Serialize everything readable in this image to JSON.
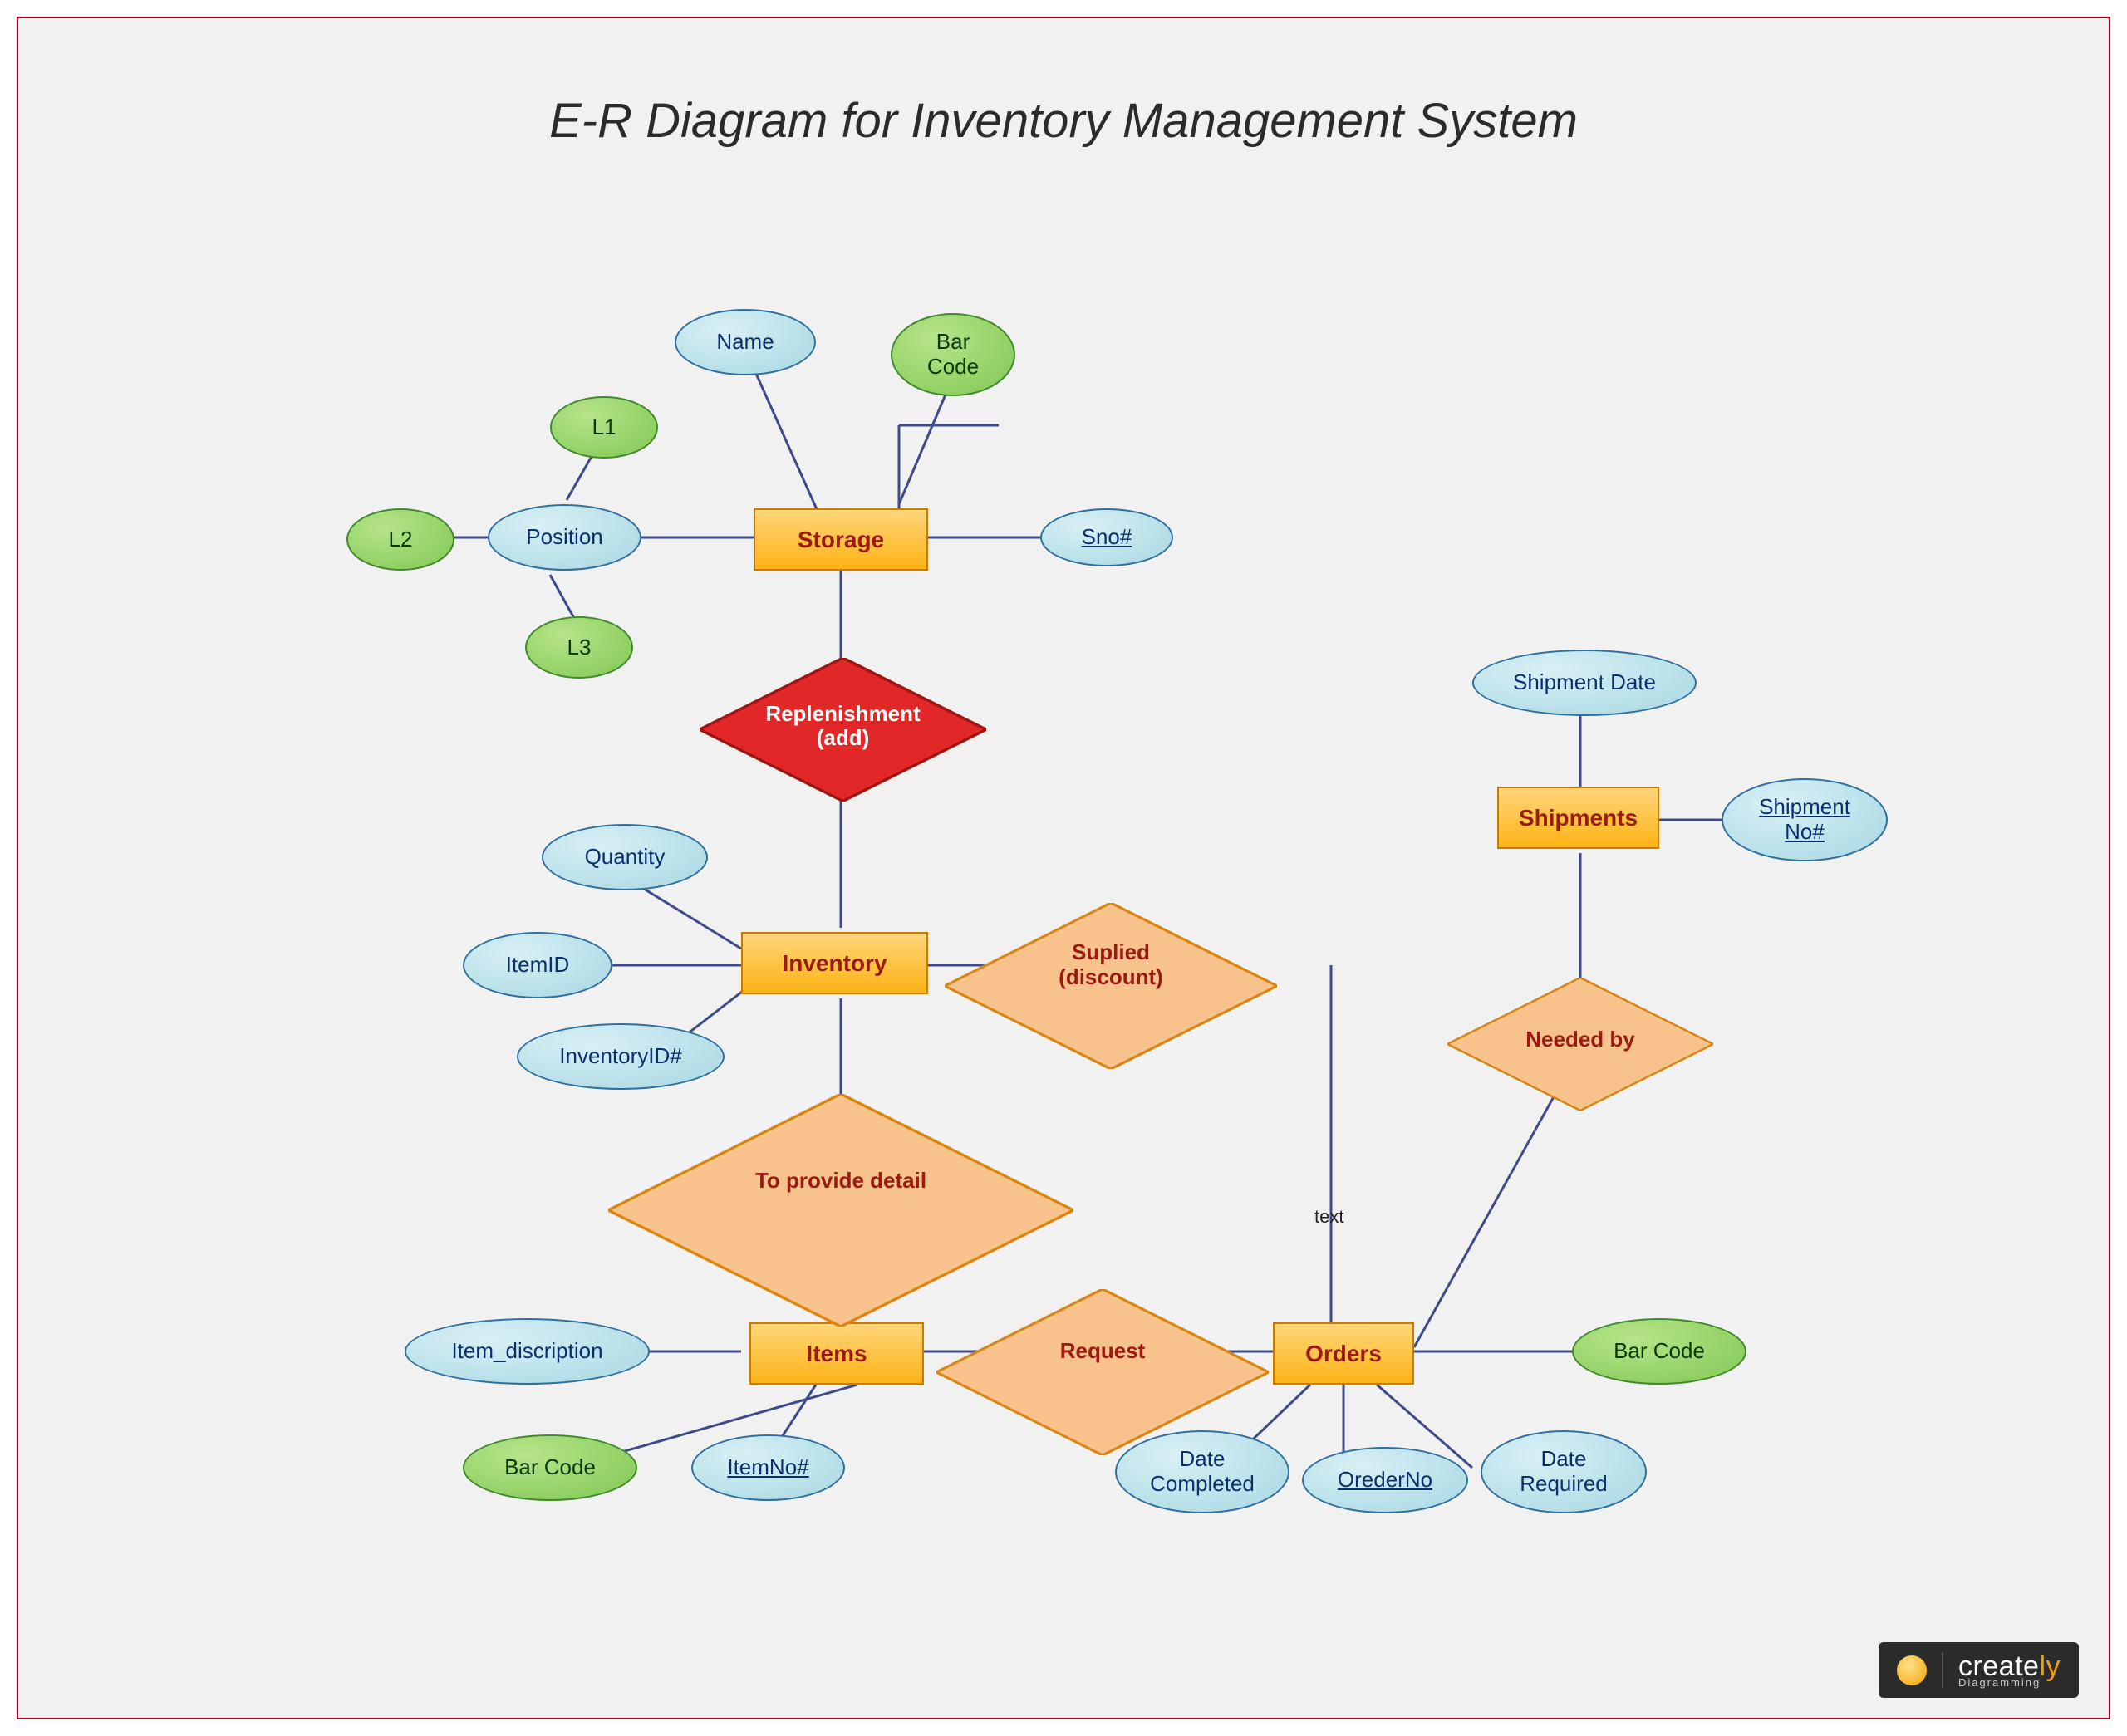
{
  "title": "E-R Diagram for Inventory Management System",
  "entities": {
    "storage": "Storage",
    "inventory": "Inventory",
    "items": "Items",
    "orders": "Orders",
    "shipments": "Shipments"
  },
  "relationships": {
    "replenishment": "Replenishment\n(add)",
    "supplied": "Suplied\n(discount)",
    "to_provide_detail": "To provide detail",
    "request": "Request",
    "needed_by": "Needed by"
  },
  "attributes": {
    "name": "Name",
    "bar_code_storage": "Bar\nCode",
    "sno": "Sno#",
    "position": "Position",
    "l1": "L1",
    "l2": "L2",
    "l3": "L3",
    "quantity": "Quantity",
    "item_id": "ItemID",
    "inventory_id": "InventoryID#",
    "item_description": "Item_discription",
    "item_no": "ItemNo#",
    "bar_code_items": "Bar Code",
    "date_completed": "Date\nCompleted",
    "order_no": "OrederNo",
    "date_required": "Date\nRequired",
    "bar_code_orders": "Bar Code",
    "shipment_date": "Shipment Date",
    "shipment_no": "Shipment\nNo#"
  },
  "labels": {
    "text": "text"
  },
  "logo": {
    "brand": "create",
    "brand_suffix": "ly",
    "sub": "Diagramming"
  },
  "colors": {
    "entity_fill": "#fcb316",
    "entity_border": "#cc7a00",
    "rel_orange": "#f7b977",
    "rel_red": "#e12727",
    "attr_blue": "#a7d7e2",
    "attr_green": "#80c853",
    "line": "#3f4a8a"
  }
}
